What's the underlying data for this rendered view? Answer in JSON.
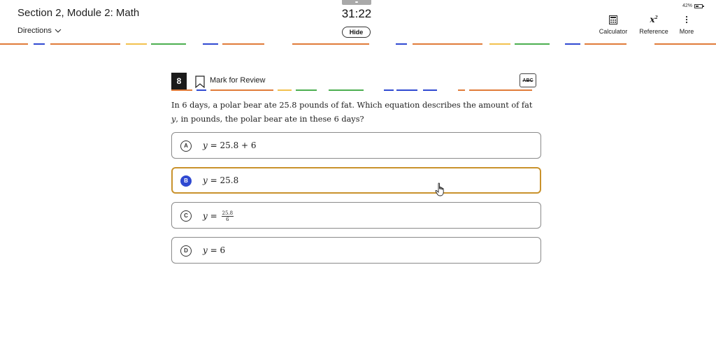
{
  "header": {
    "section_title": "Section 2, Module 2: Math",
    "directions_label": "Directions",
    "timer": "31:22",
    "hide_label": "Hide",
    "battery": "42%",
    "tools": {
      "calculator": "Calculator",
      "reference": "Reference",
      "more": "More"
    },
    "icons": [
      "chevron-down-icon",
      "calculator-icon",
      "reference-icon",
      "more-vert-icon",
      "battery-icon"
    ]
  },
  "question": {
    "number": "8",
    "mark_label": "Mark for Review",
    "abc_label": "ABC",
    "stem_parts": {
      "p1": "In ",
      "n1": "6",
      "p2": " days, a polar bear ate ",
      "n2": "25.8",
      "p3": " pounds of fat. Which equation describes the amount of fat",
      "var": "y",
      "p4": ", in pounds, the polar bear ate in these ",
      "n3": "6",
      "p5": " days?"
    },
    "choices": [
      {
        "letter": "A",
        "lhs": "y",
        "rhs": "= 25.8 + 6"
      },
      {
        "letter": "B",
        "lhs": "y",
        "rhs": "= 25.8",
        "selected": true
      },
      {
        "letter": "C",
        "lhs": "y",
        "rhs": "=",
        "frac_num": "25.8",
        "frac_den": "6"
      },
      {
        "letter": "D",
        "lhs": "y",
        "rhs": "= 6"
      }
    ]
  },
  "colors": {
    "selected_border": "#c9922c",
    "selected_letter_bg": "#2f49d1",
    "dash_orange": "#e07b39",
    "dash_blue": "#2f49d1",
    "dash_green": "#4caf50",
    "dash_yellow": "#f2c14e"
  }
}
